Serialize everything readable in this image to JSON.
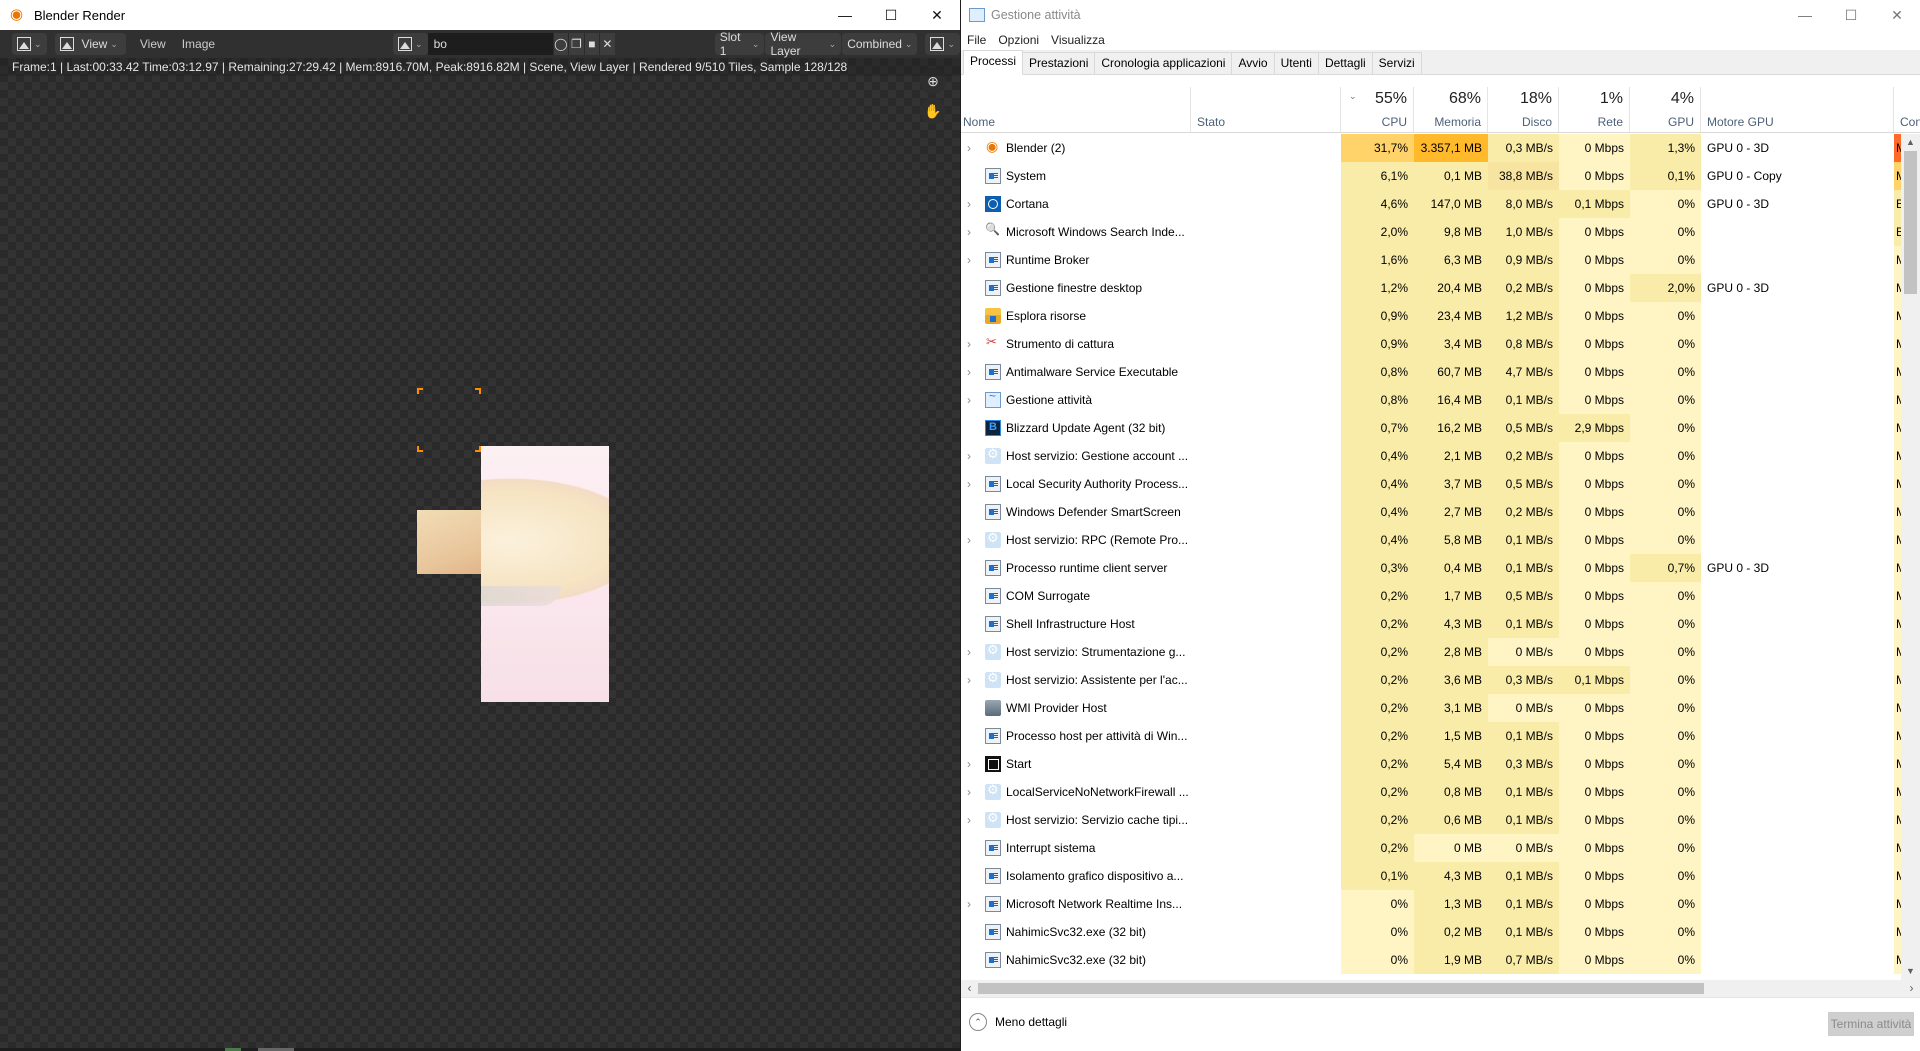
{
  "blender": {
    "title": "Blender Render",
    "header": {
      "editor_type_icon": "image-editor-icon",
      "view_menu_dropdown": "View",
      "view_menu": "View",
      "image_menu": "Image",
      "image_name": "bo",
      "slot": "Slot 1",
      "view_layer": "View Layer",
      "pass": "Combined"
    },
    "status_text": "Frame:1 | Last:00:33.42 Time:03:12.97 | Remaining:27:29.42 | Mem:8916.70M, Peak:8916.82M | Scene, View Layer | Rendered 9/510 Tiles, Sample 128/128",
    "gizmos": [
      "zoom-icon",
      "hand-pan-icon"
    ]
  },
  "taskmgr": {
    "title": "Gestione attività",
    "menu": [
      "File",
      "Opzioni",
      "Visualizza"
    ],
    "tabs": [
      "Processi",
      "Prestazioni",
      "Cronologia applicazioni",
      "Avvio",
      "Utenti",
      "Dettagli",
      "Servizi"
    ],
    "active_tab": "Processi",
    "columns": {
      "name": "Nome",
      "status": "Stato",
      "cpu": {
        "pct": "55%",
        "label": "CPU"
      },
      "mem": {
        "pct": "68%",
        "label": "Memoria"
      },
      "disk": {
        "pct": "18%",
        "label": "Disco"
      },
      "net": {
        "pct": "1%",
        "label": "Rete"
      },
      "gpu": {
        "pct": "4%",
        "label": "GPU"
      },
      "gpu_engine": "Motore GPU",
      "power": "Consu"
    },
    "processes": [
      {
        "name": "Blender (2)",
        "icon": "blender",
        "exp": true,
        "cpu": "31,7%",
        "mem": "3.357,1 MB",
        "disk": "0,3 MB/s",
        "net": "0 Mbps",
        "gpu": "1,3%",
        "engine": "GPU 0 - 3D",
        "power": "Mol",
        "hc": "heat-cpu-hi",
        "hm": "heat-mem-hi",
        "hd": "heat1",
        "hn": "heat0",
        "hg": "heat1",
        "pw": "energy-vhi"
      },
      {
        "name": "System",
        "icon": "win",
        "exp": false,
        "cpu": "6,1%",
        "mem": "0,1 MB",
        "disk": "38,8 MB/s",
        "net": "0 Mbps",
        "gpu": "0,1%",
        "engine": "GPU 0 - Copy",
        "power": "Mod",
        "hc": "heat1",
        "hm": "heat1",
        "hd": "heat2",
        "hn": "heat0",
        "hg": "heat1",
        "pw": "energy-hi"
      },
      {
        "name": "Cortana",
        "icon": "cortana",
        "exp": true,
        "cpu": "4,6%",
        "mem": "147,0 MB",
        "disk": "8,0 MB/s",
        "net": "0,1 Mbps",
        "gpu": "0%",
        "engine": "GPU 0 - 3D",
        "power": "Bas",
        "hc": "heat1",
        "hm": "heat1",
        "hd": "heat1",
        "hn": "heat1",
        "hg": "heat0",
        "pw": "energy-mid"
      },
      {
        "name": "Microsoft Windows Search Inde...",
        "icon": "search",
        "exp": true,
        "cpu": "2,0%",
        "mem": "9,8 MB",
        "disk": "1,0 MB/s",
        "net": "0 Mbps",
        "gpu": "0%",
        "engine": "",
        "power": "Bas",
        "hc": "heat1",
        "hm": "heat1",
        "hd": "heat1",
        "hn": "heat0",
        "hg": "heat0",
        "pw": "energy-mid"
      },
      {
        "name": "Runtime Broker",
        "icon": "win",
        "exp": true,
        "cpu": "1,6%",
        "mem": "6,3 MB",
        "disk": "0,9 MB/s",
        "net": "0 Mbps",
        "gpu": "0%",
        "engine": "",
        "power": "Mol",
        "hc": "heat1",
        "hm": "heat1",
        "hd": "heat1",
        "hn": "heat0",
        "hg": "heat0",
        "pw": "heat0"
      },
      {
        "name": "Gestione finestre desktop",
        "icon": "win",
        "exp": false,
        "cpu": "1,2%",
        "mem": "20,4 MB",
        "disk": "0,2 MB/s",
        "net": "0 Mbps",
        "gpu": "2,0%",
        "engine": "GPU 0 - 3D",
        "power": "Mol",
        "hc": "heat1",
        "hm": "heat1",
        "hd": "heat1",
        "hn": "heat0",
        "hg": "heat1",
        "pw": "heat0"
      },
      {
        "name": "Esplora risorse",
        "icon": "folder",
        "exp": false,
        "cpu": "0,9%",
        "mem": "23,4 MB",
        "disk": "1,2 MB/s",
        "net": "0 Mbps",
        "gpu": "0%",
        "engine": "",
        "power": "Mol",
        "hc": "heat1",
        "hm": "heat1",
        "hd": "heat1",
        "hn": "heat0",
        "hg": "heat0",
        "pw": "heat0"
      },
      {
        "name": "Strumento di cattura",
        "icon": "snip",
        "exp": true,
        "cpu": "0,9%",
        "mem": "3,4 MB",
        "disk": "0,8 MB/s",
        "net": "0 Mbps",
        "gpu": "0%",
        "engine": "",
        "power": "Mol",
        "hc": "heat1",
        "hm": "heat1",
        "hd": "heat1",
        "hn": "heat0",
        "hg": "heat0",
        "pw": "heat0"
      },
      {
        "name": "Antimalware Service Executable",
        "icon": "win",
        "exp": true,
        "cpu": "0,8%",
        "mem": "60,7 MB",
        "disk": "4,7 MB/s",
        "net": "0 Mbps",
        "gpu": "0%",
        "engine": "",
        "power": "Mol",
        "hc": "heat1",
        "hm": "heat1",
        "hd": "heat1",
        "hn": "heat0",
        "hg": "heat0",
        "pw": "heat0"
      },
      {
        "name": "Gestione attività",
        "icon": "taskmgr",
        "exp": true,
        "cpu": "0,8%",
        "mem": "16,4 MB",
        "disk": "0,1 MB/s",
        "net": "0 Mbps",
        "gpu": "0%",
        "engine": "",
        "power": "Mol",
        "hc": "heat1",
        "hm": "heat1",
        "hd": "heat1",
        "hn": "heat0",
        "hg": "heat0",
        "pw": "heat0"
      },
      {
        "name": "Blizzard Update Agent (32 bit)",
        "icon": "blizzard",
        "exp": false,
        "cpu": "0,7%",
        "mem": "16,2 MB",
        "disk": "0,5 MB/s",
        "net": "2,9 Mbps",
        "gpu": "0%",
        "engine": "",
        "power": "Mol",
        "hc": "heat1",
        "hm": "heat1",
        "hd": "heat1",
        "hn": "heat1",
        "hg": "heat0",
        "pw": "heat0"
      },
      {
        "name": "Host servizio: Gestione account ...",
        "icon": "gear",
        "exp": true,
        "cpu": "0,4%",
        "mem": "2,1 MB",
        "disk": "0,2 MB/s",
        "net": "0 Mbps",
        "gpu": "0%",
        "engine": "",
        "power": "Mol",
        "hc": "heat1",
        "hm": "heat1",
        "hd": "heat1",
        "hn": "heat0",
        "hg": "heat0",
        "pw": "heat0"
      },
      {
        "name": "Local Security Authority Process...",
        "icon": "win",
        "exp": true,
        "cpu": "0,4%",
        "mem": "3,7 MB",
        "disk": "0,5 MB/s",
        "net": "0 Mbps",
        "gpu": "0%",
        "engine": "",
        "power": "Mol",
        "hc": "heat1",
        "hm": "heat1",
        "hd": "heat1",
        "hn": "heat0",
        "hg": "heat0",
        "pw": "heat0"
      },
      {
        "name": "Windows Defender SmartScreen",
        "icon": "win",
        "exp": false,
        "cpu": "0,4%",
        "mem": "2,7 MB",
        "disk": "0,2 MB/s",
        "net": "0 Mbps",
        "gpu": "0%",
        "engine": "",
        "power": "Mol",
        "hc": "heat1",
        "hm": "heat1",
        "hd": "heat1",
        "hn": "heat0",
        "hg": "heat0",
        "pw": "heat0"
      },
      {
        "name": "Host servizio: RPC (Remote Pro...",
        "icon": "gear",
        "exp": true,
        "cpu": "0,4%",
        "mem": "5,8 MB",
        "disk": "0,1 MB/s",
        "net": "0 Mbps",
        "gpu": "0%",
        "engine": "",
        "power": "Mol",
        "hc": "heat1",
        "hm": "heat1",
        "hd": "heat1",
        "hn": "heat0",
        "hg": "heat0",
        "pw": "heat0"
      },
      {
        "name": "Processo runtime client server",
        "icon": "win",
        "exp": false,
        "cpu": "0,3%",
        "mem": "0,4 MB",
        "disk": "0,1 MB/s",
        "net": "0 Mbps",
        "gpu": "0,7%",
        "engine": "GPU 0 - 3D",
        "power": "Mol",
        "hc": "heat1",
        "hm": "heat1",
        "hd": "heat1",
        "hn": "heat0",
        "hg": "heat1",
        "pw": "heat0"
      },
      {
        "name": "COM Surrogate",
        "icon": "win",
        "exp": false,
        "cpu": "0,2%",
        "mem": "1,7 MB",
        "disk": "0,5 MB/s",
        "net": "0 Mbps",
        "gpu": "0%",
        "engine": "",
        "power": "Mol",
        "hc": "heat1",
        "hm": "heat1",
        "hd": "heat1",
        "hn": "heat0",
        "hg": "heat0",
        "pw": "heat0"
      },
      {
        "name": "Shell Infrastructure Host",
        "icon": "win",
        "exp": false,
        "cpu": "0,2%",
        "mem": "4,3 MB",
        "disk": "0,1 MB/s",
        "net": "0 Mbps",
        "gpu": "0%",
        "engine": "",
        "power": "Mol",
        "hc": "heat1",
        "hm": "heat1",
        "hd": "heat1",
        "hn": "heat0",
        "hg": "heat0",
        "pw": "heat0"
      },
      {
        "name": "Host servizio: Strumentazione g...",
        "icon": "gear",
        "exp": true,
        "cpu": "0,2%",
        "mem": "2,8 MB",
        "disk": "0 MB/s",
        "net": "0 Mbps",
        "gpu": "0%",
        "engine": "",
        "power": "Mol",
        "hc": "heat1",
        "hm": "heat1",
        "hd": "heat0",
        "hn": "heat0",
        "hg": "heat0",
        "pw": "heat0"
      },
      {
        "name": "Host servizio: Assistente per l'ac...",
        "icon": "gear",
        "exp": true,
        "cpu": "0,2%",
        "mem": "3,6 MB",
        "disk": "0,3 MB/s",
        "net": "0,1 Mbps",
        "gpu": "0%",
        "engine": "",
        "power": "Mol",
        "hc": "heat1",
        "hm": "heat1",
        "hd": "heat1",
        "hn": "heat1",
        "hg": "heat0",
        "pw": "heat0"
      },
      {
        "name": "WMI Provider Host",
        "icon": "wmi",
        "exp": false,
        "cpu": "0,2%",
        "mem": "3,1 MB",
        "disk": "0 MB/s",
        "net": "0 Mbps",
        "gpu": "0%",
        "engine": "",
        "power": "Mol",
        "hc": "heat1",
        "hm": "heat1",
        "hd": "heat0",
        "hn": "heat0",
        "hg": "heat0",
        "pw": "heat0"
      },
      {
        "name": "Processo host per attività di Win...",
        "icon": "win",
        "exp": false,
        "cpu": "0,2%",
        "mem": "1,5 MB",
        "disk": "0,1 MB/s",
        "net": "0 Mbps",
        "gpu": "0%",
        "engine": "",
        "power": "Mol",
        "hc": "heat1",
        "hm": "heat1",
        "hd": "heat1",
        "hn": "heat0",
        "hg": "heat0",
        "pw": "heat0"
      },
      {
        "name": "Start",
        "icon": "start",
        "exp": true,
        "cpu": "0,2%",
        "mem": "5,4 MB",
        "disk": "0,3 MB/s",
        "net": "0 Mbps",
        "gpu": "0%",
        "engine": "",
        "power": "Mol",
        "hc": "heat1",
        "hm": "heat1",
        "hd": "heat1",
        "hn": "heat0",
        "hg": "heat0",
        "pw": "heat0"
      },
      {
        "name": "LocalServiceNoNetworkFirewall ...",
        "icon": "gear",
        "exp": true,
        "cpu": "0,2%",
        "mem": "0,8 MB",
        "disk": "0,1 MB/s",
        "net": "0 Mbps",
        "gpu": "0%",
        "engine": "",
        "power": "Mol",
        "hc": "heat1",
        "hm": "heat1",
        "hd": "heat1",
        "hn": "heat0",
        "hg": "heat0",
        "pw": "heat0"
      },
      {
        "name": "Host servizio: Servizio cache tipi...",
        "icon": "gear",
        "exp": true,
        "cpu": "0,2%",
        "mem": "0,6 MB",
        "disk": "0,1 MB/s",
        "net": "0 Mbps",
        "gpu": "0%",
        "engine": "",
        "power": "Mol",
        "hc": "heat1",
        "hm": "heat1",
        "hd": "heat1",
        "hn": "heat0",
        "hg": "heat0",
        "pw": "heat0"
      },
      {
        "name": "Interrupt sistema",
        "icon": "win",
        "exp": false,
        "cpu": "0,2%",
        "mem": "0 MB",
        "disk": "0 MB/s",
        "net": "0 Mbps",
        "gpu": "0%",
        "engine": "",
        "power": "Mol",
        "hc": "heat1",
        "hm": "heat0",
        "hd": "heat0",
        "hn": "heat0",
        "hg": "heat0",
        "pw": "heat0"
      },
      {
        "name": "Isolamento grafico dispositivo a...",
        "icon": "win",
        "exp": false,
        "cpu": "0,1%",
        "mem": "4,3 MB",
        "disk": "0,1 MB/s",
        "net": "0 Mbps",
        "gpu": "0%",
        "engine": "",
        "power": "Mol",
        "hc": "heat1",
        "hm": "heat1",
        "hd": "heat1",
        "hn": "heat0",
        "hg": "heat0",
        "pw": "heat0"
      },
      {
        "name": "Microsoft Network Realtime Ins...",
        "icon": "win",
        "exp": true,
        "cpu": "0%",
        "mem": "1,3 MB",
        "disk": "0,1 MB/s",
        "net": "0 Mbps",
        "gpu": "0%",
        "engine": "",
        "power": "Mol",
        "hc": "heat0",
        "hm": "heat1",
        "hd": "heat1",
        "hn": "heat0",
        "hg": "heat0",
        "pw": "heat0"
      },
      {
        "name": "NahimicSvc32.exe (32 bit)",
        "icon": "win",
        "exp": false,
        "cpu": "0%",
        "mem": "0,2 MB",
        "disk": "0,1 MB/s",
        "net": "0 Mbps",
        "gpu": "0%",
        "engine": "",
        "power": "Mol",
        "hc": "heat0",
        "hm": "heat1",
        "hd": "heat1",
        "hn": "heat0",
        "hg": "heat0",
        "pw": "heat0"
      },
      {
        "name": "NahimicSvc32.exe (32 bit)",
        "icon": "win",
        "exp": false,
        "cpu": "0%",
        "mem": "1,9 MB",
        "disk": "0,7 MB/s",
        "net": "0 Mbps",
        "gpu": "0%",
        "engine": "",
        "power": "Mol",
        "hc": "heat0",
        "hm": "heat1",
        "hd": "heat1",
        "hn": "heat0",
        "hg": "heat0",
        "pw": "heat0"
      }
    ],
    "footer": {
      "fewer_details": "Meno dettagli",
      "end_task": "Termina attività"
    }
  }
}
